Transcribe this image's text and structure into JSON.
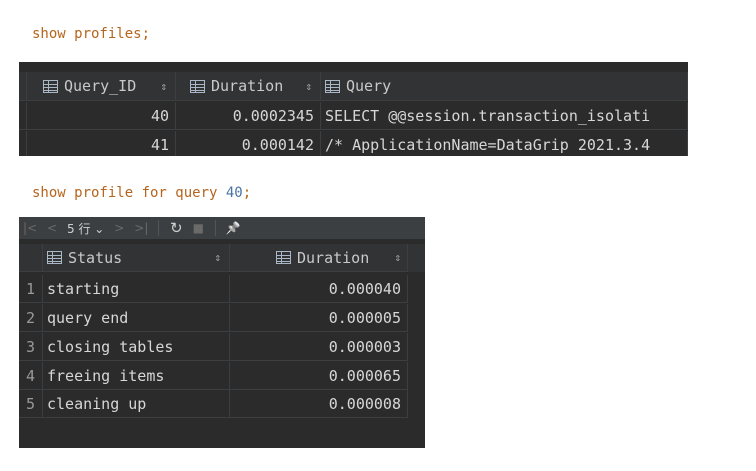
{
  "query1": {
    "keyword": "show profiles",
    "terminator": ";"
  },
  "grid1": {
    "columns": [
      "Query_ID",
      "Duration",
      "Query"
    ],
    "rows": [
      {
        "query_id": "40",
        "duration": "0.0002345",
        "query": "SELECT @@session.transaction_isolati"
      },
      {
        "query_id": "41",
        "duration": "0.000142",
        "query": "/* ApplicationName=DataGrip 2021.3.4"
      }
    ]
  },
  "query2": {
    "keyword": "show profile for query",
    "number": "40",
    "terminator": ";"
  },
  "grid2": {
    "toolbar": {
      "first": "|<",
      "prev": "<",
      "page_size": "5 行 ⌄",
      "next": ">",
      "last": ">|",
      "refresh": "↻",
      "stop": "■",
      "pin": "📌"
    },
    "columns": [
      "Status",
      "Duration"
    ],
    "rows": [
      {
        "n": "1",
        "status": "starting",
        "duration": "0.000040"
      },
      {
        "n": "2",
        "status": "query end",
        "duration": "0.000005"
      },
      {
        "n": "3",
        "status": "closing tables",
        "duration": "0.000003"
      },
      {
        "n": "4",
        "status": "freeing items",
        "duration": "0.000065"
      },
      {
        "n": "5",
        "status": "cleaning up",
        "duration": "0.000008"
      }
    ]
  },
  "colors": {
    "keyword": "#b5651d",
    "number": "#4a72a6",
    "grid_bg": "#2b2b2b"
  }
}
